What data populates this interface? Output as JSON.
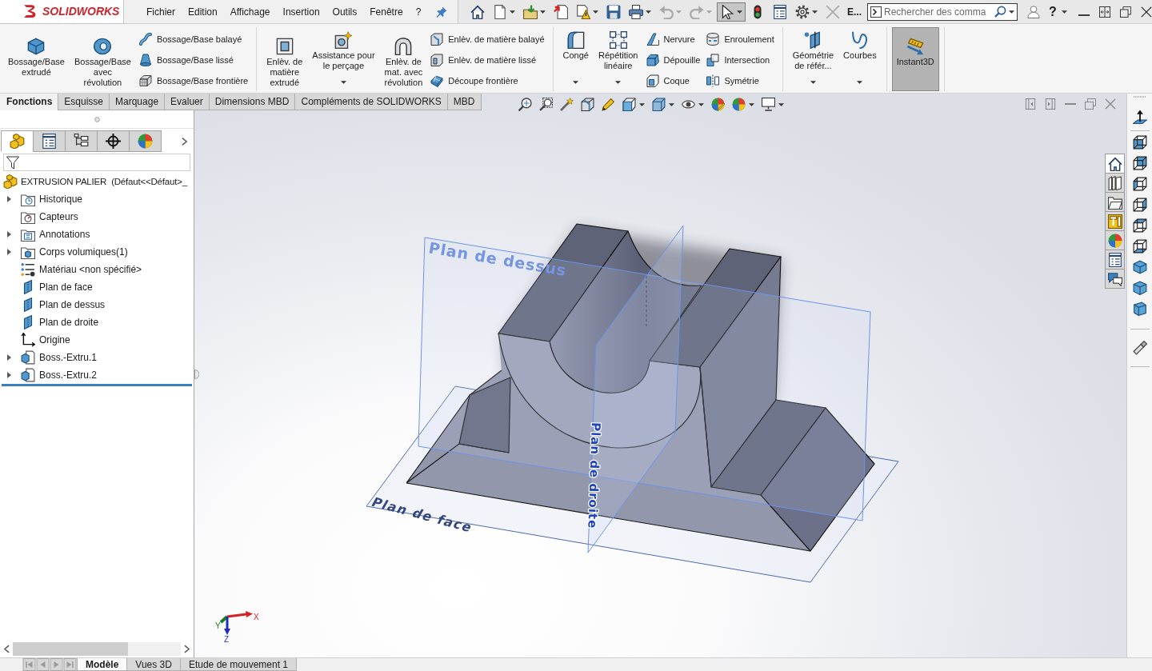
{
  "logo": {
    "wordmark": "SOLIDWORKS"
  },
  "menu": [
    {
      "label": "Fichier"
    },
    {
      "label": "Edition"
    },
    {
      "label": "Affichage"
    },
    {
      "label": "Insertion"
    },
    {
      "label": "Outils"
    },
    {
      "label": "Fenêtre"
    },
    {
      "label": "?"
    }
  ],
  "quick_access": {
    "tools": [
      {
        "kind": "home",
        "dropdown": false,
        "disabled": false,
        "pressed": false
      },
      {
        "kind": "new",
        "dropdown": true,
        "disabled": false,
        "pressed": false
      },
      {
        "kind": "open",
        "dropdown": true,
        "disabled": false,
        "pressed": false
      },
      {
        "kind": "export",
        "dropdown": false,
        "disabled": false,
        "pressed": false
      },
      {
        "kind": "check",
        "dropdown": true,
        "disabled": false,
        "pressed": false
      },
      {
        "kind": "save",
        "dropdown": false,
        "disabled": false,
        "pressed": false
      },
      {
        "kind": "print",
        "dropdown": true,
        "disabled": false,
        "pressed": false
      },
      {
        "kind": "undo",
        "dropdown": true,
        "disabled": true,
        "pressed": false
      },
      {
        "kind": "redo",
        "dropdown": true,
        "disabled": true,
        "pressed": false
      },
      {
        "kind": "select",
        "dropdown": true,
        "disabled": false,
        "pressed": true
      },
      {
        "kind": "rebuild",
        "dropdown": false,
        "disabled": false,
        "pressed": false
      },
      {
        "kind": "properties",
        "dropdown": false,
        "disabled": false,
        "pressed": false
      },
      {
        "kind": "options",
        "dropdown": true,
        "disabled": false,
        "pressed": false
      },
      {
        "kind": "close",
        "dropdown": false,
        "disabled": true,
        "pressed": false
      }
    ],
    "document_title": "E...",
    "search": {
      "placeholder": "Rechercher des comma"
    },
    "help": "?"
  },
  "ribbon": {
    "groups": [
      {
        "large": [
          {
            "kind": "extrude",
            "lines": [
              "Bossage/Base",
              "extrudé"
            ],
            "dropdown": false,
            "active": false
          },
          {
            "kind": "revolve",
            "lines": [
              "Bossage/Base",
              "avec",
              "révolution"
            ],
            "dropdown": false,
            "active": false
          }
        ],
        "columns": [
          [
            {
              "kind": "swept",
              "label": "Bossage/Base balayé"
            },
            {
              "kind": "loft",
              "label": "Bossage/Base lissé"
            },
            {
              "kind": "boundary",
              "label": "Bossage/Base frontière"
            }
          ]
        ]
      },
      {
        "large": [
          {
            "kind": "cut_extrude",
            "lines": [
              "Enlèv. de",
              "matière",
              "extrudé"
            ],
            "dropdown": false,
            "active": false
          },
          {
            "kind": "hole_wizard",
            "lines": [
              "Assistance pour",
              "le perçage"
            ],
            "dropdown": true,
            "active": false
          },
          {
            "kind": "cut_revolve",
            "lines": [
              "Enlèv. de",
              "mat. avec",
              "révolution"
            ],
            "dropdown": false,
            "active": false
          }
        ],
        "columns": [
          [
            {
              "kind": "cut_swept",
              "label": "Enlèv. de matière balayé"
            },
            {
              "kind": "cut_loft",
              "label": "Enlèv. de matière lissé"
            },
            {
              "kind": "boundary_cut",
              "label": "Découpe frontière"
            }
          ]
        ]
      },
      {
        "large": [
          {
            "kind": "fillet",
            "lines": [
              "Congé"
            ],
            "dropdown": true,
            "active": false
          },
          {
            "kind": "linear_pattern",
            "lines": [
              "Répétition",
              "linéaire"
            ],
            "dropdown": true,
            "active": false
          }
        ],
        "columns": [
          [
            {
              "kind": "rib",
              "label": "Nervure"
            },
            {
              "kind": "draft",
              "label": "Dépouille"
            },
            {
              "kind": "shell",
              "label": "Coque"
            }
          ],
          [
            {
              "kind": "wrap",
              "label": "Enroulement"
            },
            {
              "kind": "intersect",
              "label": "Intersection"
            },
            {
              "kind": "mirror",
              "label": "Symétrie"
            }
          ]
        ]
      },
      {
        "large": [
          {
            "kind": "reference_geometry",
            "lines": [
              "Géométrie",
              "de référ..."
            ],
            "dropdown": true,
            "active": false
          },
          {
            "kind": "curves",
            "lines": [
              "Courbes"
            ],
            "dropdown": true,
            "active": false
          }
        ]
      },
      {
        "large": [
          {
            "kind": "instant3d",
            "lines": [
              "Instant3D"
            ],
            "dropdown": false,
            "active": true
          }
        ]
      }
    ]
  },
  "command_tabs": [
    {
      "label": "Fonctions",
      "selected": true
    },
    {
      "label": "Esquisse",
      "selected": false
    },
    {
      "label": "Marquage",
      "selected": false
    },
    {
      "label": "Evaluer",
      "selected": false
    },
    {
      "label": "Dimensions MBD",
      "selected": false
    },
    {
      "label": "Compléments de SOLIDWORKS",
      "selected": false
    },
    {
      "label": "MBD",
      "selected": false
    }
  ],
  "feature_manager": {
    "tabs": [
      {
        "kind": "part",
        "selected": true
      },
      {
        "kind": "properties",
        "selected": false
      },
      {
        "kind": "configurations",
        "selected": false
      },
      {
        "kind": "dimxpert",
        "selected": false
      },
      {
        "kind": "display",
        "selected": false
      }
    ],
    "tree": {
      "root": {
        "kind": "part",
        "label": "EXTRUSION PALIER  (Défaut<<Défaut>_"
      },
      "items": [
        {
          "kind": "history",
          "label": "Historique",
          "expanded": false
        },
        {
          "kind": "sensors",
          "label": "Capteurs"
        },
        {
          "kind": "annotations",
          "label": "Annotations",
          "expanded": false
        },
        {
          "kind": "bodies",
          "label": "Corps volumiques(1)",
          "expanded": false
        },
        {
          "kind": "material",
          "label": "Matériau <non spécifié>"
        },
        {
          "kind": "plane",
          "label": "Plan de face"
        },
        {
          "kind": "plane",
          "label": "Plan de dessus"
        },
        {
          "kind": "plane",
          "label": "Plan de droite"
        },
        {
          "kind": "origin",
          "label": "Origine"
        },
        {
          "kind": "feature",
          "label": "Boss.-Extru.1",
          "expanded": false
        },
        {
          "kind": "feature",
          "label": "Boss.-Extru.2",
          "expanded": false
        }
      ]
    }
  },
  "viewport": {
    "planes": [
      {
        "label": "Plan de dessus"
      },
      {
        "label": "Plan de face"
      },
      {
        "label": "Plan de droite"
      }
    ],
    "triad": {
      "x": "X",
      "y": "Y",
      "z": "Z"
    },
    "task_pane_tabs": [
      {
        "kind": "home",
        "selected": true
      },
      {
        "kind": "library",
        "selected": false
      },
      {
        "kind": "explorer",
        "selected": false
      },
      {
        "kind": "design_library",
        "selected": false
      },
      {
        "kind": "appearances",
        "selected": false
      },
      {
        "kind": "properties",
        "selected": false
      },
      {
        "kind": "forum",
        "selected": false
      }
    ]
  },
  "bottom_tabs": [
    {
      "label": "Modèle",
      "selected": true
    },
    {
      "label": "Vues 3D",
      "selected": false
    },
    {
      "label": "Etude de mouvement 1",
      "selected": false
    }
  ]
}
